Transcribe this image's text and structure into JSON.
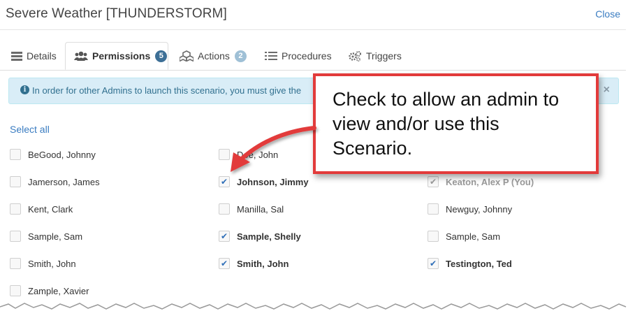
{
  "modal": {
    "title": "Severe Weather [THUNDERSTORM]",
    "close_label": "Close"
  },
  "tabs": [
    {
      "label": "Details",
      "icon": "list-icon"
    },
    {
      "label": "Permissions",
      "icon": "users-icon",
      "badge": "5"
    },
    {
      "label": "Actions",
      "icon": "cubes-icon",
      "badge": "2"
    },
    {
      "label": "Procedures",
      "icon": "list-lines-icon"
    },
    {
      "label": "Triggers",
      "icon": "gears-icon"
    }
  ],
  "alert": {
    "message": "In order for other Admins to launch this scenario, you must give the",
    "dismiss": "×"
  },
  "select_all_label": "Select all",
  "admins": {
    "col1": [
      {
        "name": "BeGood, Johnny",
        "checked": false
      },
      {
        "name": "Jamerson, James",
        "checked": false
      },
      {
        "name": "Kent, Clark",
        "checked": false
      },
      {
        "name": "Sample, Sam",
        "checked": false
      },
      {
        "name": "Smith, John",
        "checked": false
      },
      {
        "name": "Zample, Xavier",
        "checked": false
      }
    ],
    "col2": [
      {
        "name": "Doe, John",
        "checked": false
      },
      {
        "name": "Johnson, Jimmy",
        "checked": true
      },
      {
        "name": "Manilla, Sal",
        "checked": false
      },
      {
        "name": "Sample, Shelly",
        "checked": true
      },
      {
        "name": "Smith, John",
        "checked": true
      }
    ],
    "col3": [
      {
        "name": "Keaton, Alex P (You)",
        "checked": true,
        "disabled": true
      },
      {
        "name": "Newguy, Johnny",
        "checked": false
      },
      {
        "name": "Sample, Sam",
        "checked": false
      },
      {
        "name": "Testington, Ted",
        "checked": true
      }
    ]
  },
  "callout": {
    "text": "Check to allow an admin to view and/or use this Scenario."
  },
  "colors": {
    "link": "#3a7cc1",
    "callout_border": "#e23b3b",
    "badge_active": "#3d6f96",
    "badge_inactive": "#9fc0d6"
  }
}
